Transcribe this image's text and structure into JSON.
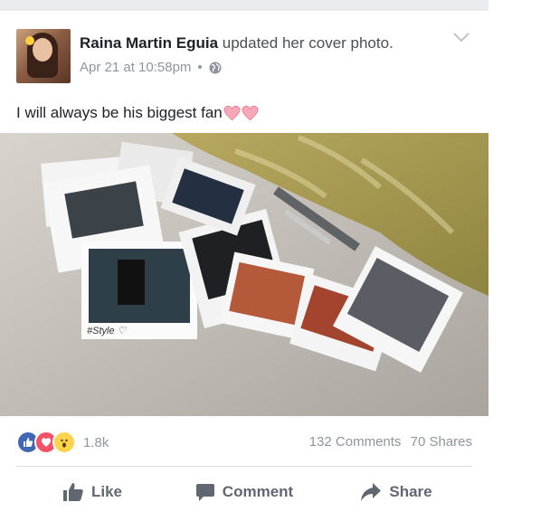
{
  "post": {
    "author": "Raina Martin Eguia",
    "action": "updated her cover photo.",
    "date": "Apr 21 at 10:58pm",
    "separator": "•",
    "privacy_icon": "globe-icon",
    "menu_icon": "chevron-down-icon",
    "text": "I will always be his biggest fan",
    "emoji_after_text": [
      "pink-heart",
      "pink-heart"
    ]
  },
  "photo": {
    "description_icons": [
      "polaroid-photos",
      "pen",
      "pillow"
    ],
    "caption_on_polaroid": "#Style ♡"
  },
  "stats": {
    "reactions": [
      "like",
      "love",
      "wow"
    ],
    "reaction_count": "1.8k",
    "comments": "132 Comments",
    "shares": "70 Shares"
  },
  "actions": {
    "like": "Like",
    "comment": "Comment",
    "share": "Share"
  },
  "colors": {
    "like_blue": "#4267b2",
    "love_red": "#f25268",
    "wow_yellow": "#fcd34d",
    "text_secondary": "#90949c"
  }
}
